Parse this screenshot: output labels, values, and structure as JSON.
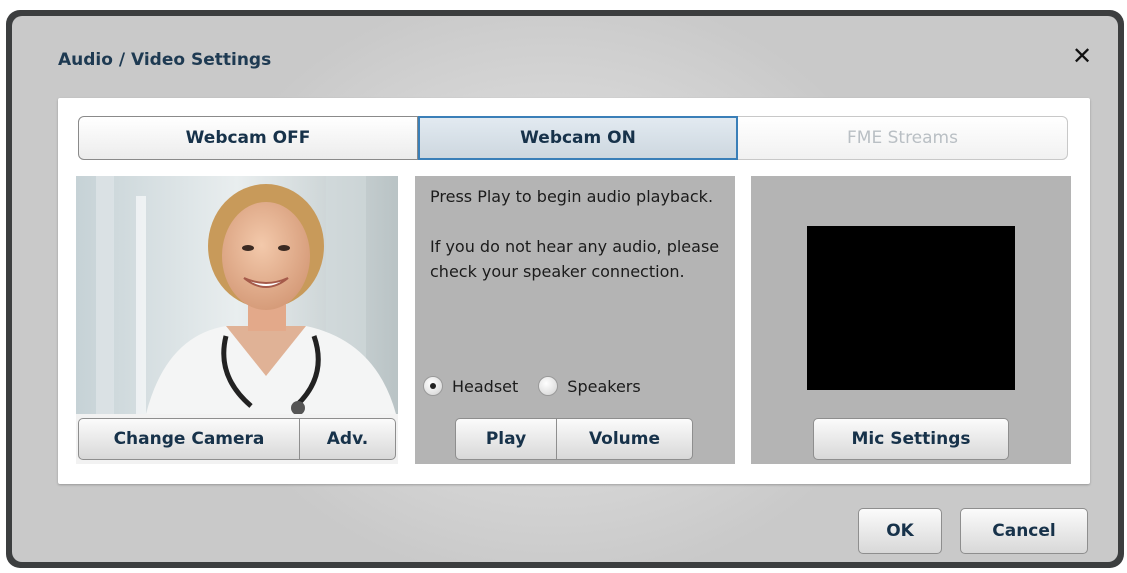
{
  "dialog": {
    "title": "Audio / Video Settings",
    "close_label": "✕"
  },
  "tabs": [
    {
      "label": "Webcam OFF",
      "state": "normal"
    },
    {
      "label": "Webcam ON",
      "state": "selected"
    },
    {
      "label": "FME Streams",
      "state": "disabled"
    }
  ],
  "camera": {
    "change_label": "Change Camera",
    "adv_label": "Adv."
  },
  "audio": {
    "instruction_1": "Press Play to begin audio playback.",
    "instruction_2": "If you do not hear any audio, please check your speaker connection.",
    "radio_options": [
      {
        "label": "Headset",
        "checked": true
      },
      {
        "label": "Speakers",
        "checked": false
      }
    ],
    "play_label": "Play",
    "volume_label": "Volume"
  },
  "mic": {
    "settings_label": "Mic Settings"
  },
  "footer": {
    "ok_label": "OK",
    "cancel_label": "Cancel"
  },
  "colors": {
    "title_text": "#1e3a52",
    "selected_tab_border": "#3a7fb8",
    "panel_bg": "#b4b4b4",
    "dialog_frame": "#3c3e3f"
  }
}
